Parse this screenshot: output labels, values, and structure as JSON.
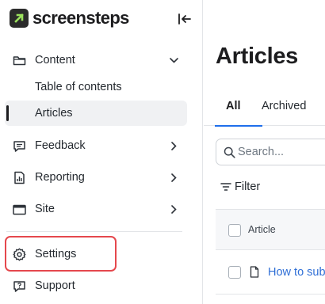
{
  "brand": {
    "name": "screensteps",
    "logo_bg": "#2b2b2b",
    "logo_accent": "#9be15d"
  },
  "sidebar": {
    "content": {
      "label": "Content",
      "icon": "folder-icon"
    },
    "sub_items": [
      {
        "label": "Table of contents"
      },
      {
        "label": "Articles",
        "active": true
      }
    ],
    "items": [
      {
        "label": "Feedback",
        "icon": "chat-icon"
      },
      {
        "label": "Reporting",
        "icon": "report-icon"
      },
      {
        "label": "Site",
        "icon": "site-icon"
      }
    ],
    "settings": {
      "label": "Settings",
      "icon": "gear-icon",
      "highlight_color": "#e5484d"
    },
    "support": {
      "label": "Support",
      "icon": "support-icon"
    }
  },
  "main": {
    "title": "Articles",
    "tabs": [
      {
        "label": "All",
        "active": true
      },
      {
        "label": "Archived"
      }
    ],
    "search": {
      "placeholder": "Search..."
    },
    "filter_label": "Filter",
    "table": {
      "header": "Article",
      "rows": [
        {
          "title": "How to sub"
        }
      ]
    },
    "accent": "#1f6feb",
    "link_color": "#2f6fd6"
  }
}
